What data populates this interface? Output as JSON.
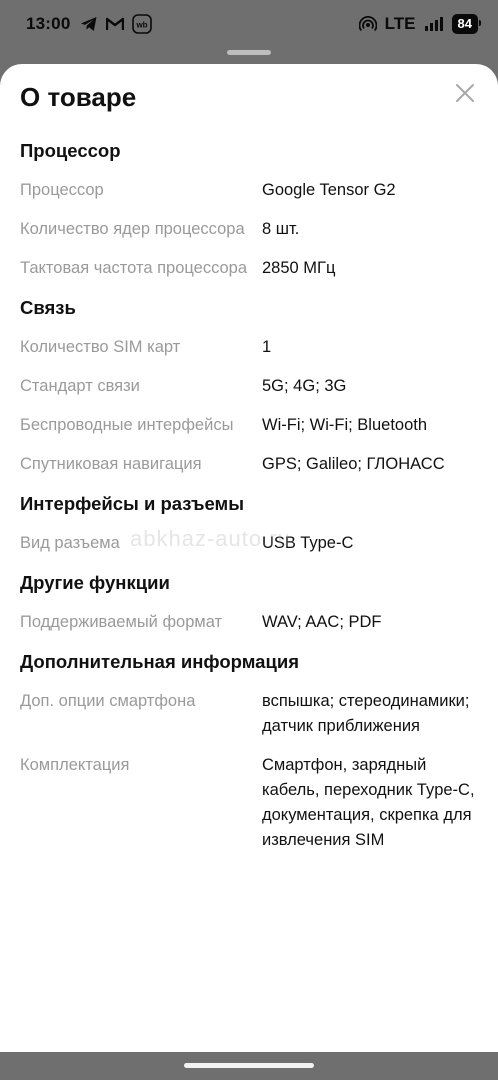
{
  "status_bar": {
    "time": "13:00",
    "network": "LTE",
    "battery": "84"
  },
  "sheet": {
    "title": "О товаре"
  },
  "sections": [
    {
      "title": "Процессор",
      "rows": [
        {
          "key": "Процессор",
          "value": "Google Tensor G2"
        },
        {
          "key": "Количество ядер процессора",
          "value": "8 шт."
        },
        {
          "key": "Тактовая частота процессора",
          "value": "2850 МГц"
        }
      ]
    },
    {
      "title": "Связь",
      "rows": [
        {
          "key": "Количество SIM карт",
          "value": "1"
        },
        {
          "key": "Стандарт связи",
          "value": "5G; 4G; 3G"
        },
        {
          "key": "Беспроводные интерфейсы",
          "value": "Wi-Fi; Wi-Fi; Bluetooth"
        },
        {
          "key": "Спутниковая навигация",
          "value": "GPS; Galileo; ГЛОНАСС"
        }
      ]
    },
    {
      "title": "Интерфейсы и разъемы",
      "rows": [
        {
          "key": "Вид разъема",
          "value": "USB Type-C"
        }
      ]
    },
    {
      "title": "Другие функции",
      "rows": [
        {
          "key": "Поддерживаемый формат",
          "value": "WAV; AAC; PDF"
        }
      ]
    },
    {
      "title": "Дополнительная информация",
      "rows": [
        {
          "key": "Доп. опции смартфона",
          "value": "вспышка; стереодинамики; датчик приближения"
        },
        {
          "key": "Комплектация",
          "value": "Смартфон, зарядный кабель, переходник Type-C, документация, скрепка для извлечения SIM"
        }
      ]
    }
  ],
  "watermark": "abkhaz-auto.ru",
  "colors": {
    "overlay": "#6f6f6f",
    "key_text": "#9a9a9a",
    "value_text": "#111111"
  }
}
